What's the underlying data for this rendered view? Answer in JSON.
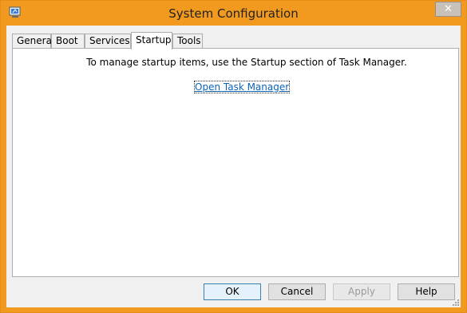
{
  "window": {
    "title": "System Configuration",
    "close_glyph": "✕"
  },
  "tabs": [
    {
      "label": "General",
      "selected": false
    },
    {
      "label": "Boot",
      "selected": false
    },
    {
      "label": "Services",
      "selected": false
    },
    {
      "label": "Startup",
      "selected": true
    },
    {
      "label": "Tools",
      "selected": false
    }
  ],
  "startup": {
    "message": "To manage startup items, use the Startup section of Task Manager.",
    "link": "Open Task Manager"
  },
  "buttons": {
    "ok": "OK",
    "cancel": "Cancel",
    "apply": "Apply",
    "help": "Help"
  },
  "colors": {
    "titlebar": "#f29a1f",
    "link": "#0b64b8"
  },
  "icons": {
    "app": "msconfig-icon",
    "close": "close-icon",
    "grip": "resize-grip-icon"
  }
}
